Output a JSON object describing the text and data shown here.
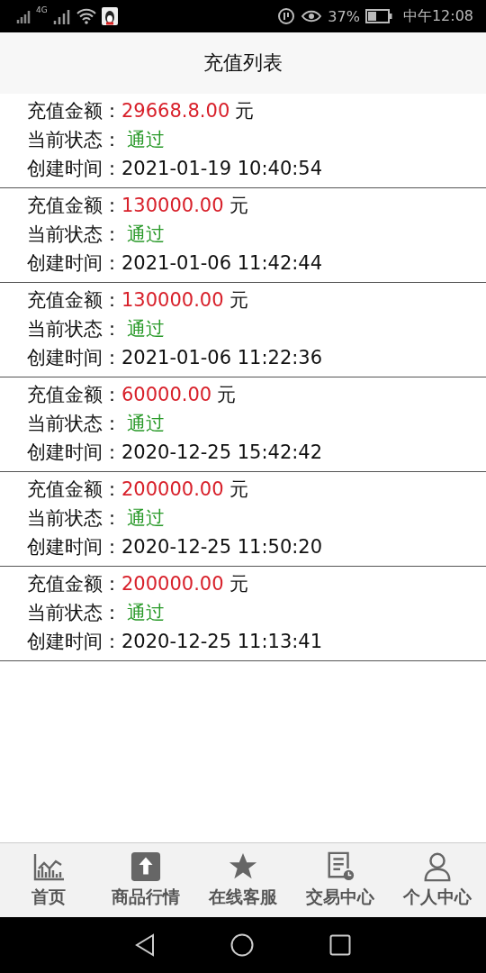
{
  "status_bar": {
    "network": "4G",
    "battery": "37%",
    "time": "中午12:08"
  },
  "header": {
    "title": "充值列表"
  },
  "records": [
    {
      "amount_label": "充值金额：",
      "amount": "29668.8.00",
      "unit": "元",
      "status_label": "当前状态：",
      "status": "通过",
      "time_label": "创建时间：",
      "time": "2021-01-19 10:40:54"
    },
    {
      "amount_label": "充值金额：",
      "amount": "130000.00",
      "unit": "元",
      "status_label": "当前状态：",
      "status": "通过",
      "time_label": "创建时间：",
      "time": "2021-01-06 11:42:44"
    },
    {
      "amount_label": "充值金额：",
      "amount": "130000.00",
      "unit": "元",
      "status_label": "当前状态：",
      "status": "通过",
      "time_label": "创建时间：",
      "time": "2021-01-06 11:22:36"
    },
    {
      "amount_label": "充值金额：",
      "amount": "60000.00",
      "unit": "元",
      "status_label": "当前状态：",
      "status": "通过",
      "time_label": "创建时间：",
      "time": "2020-12-25 15:42:42"
    },
    {
      "amount_label": "充值金额：",
      "amount": "200000.00",
      "unit": "元",
      "status_label": "当前状态：",
      "status": "通过",
      "time_label": "创建时间：",
      "time": "2020-12-25 11:50:20"
    },
    {
      "amount_label": "充值金额：",
      "amount": "200000.00",
      "unit": "元",
      "status_label": "当前状态：",
      "status": "通过",
      "time_label": "创建时间：",
      "time": "2020-12-25 11:13:41"
    }
  ],
  "tab_bar": [
    {
      "kind": "chart",
      "label": "首页"
    },
    {
      "kind": "upload",
      "label": "商品行情"
    },
    {
      "kind": "star",
      "label": "在线客服"
    },
    {
      "kind": "document",
      "label": "交易中心"
    },
    {
      "kind": "person",
      "label": "个人中心"
    }
  ]
}
